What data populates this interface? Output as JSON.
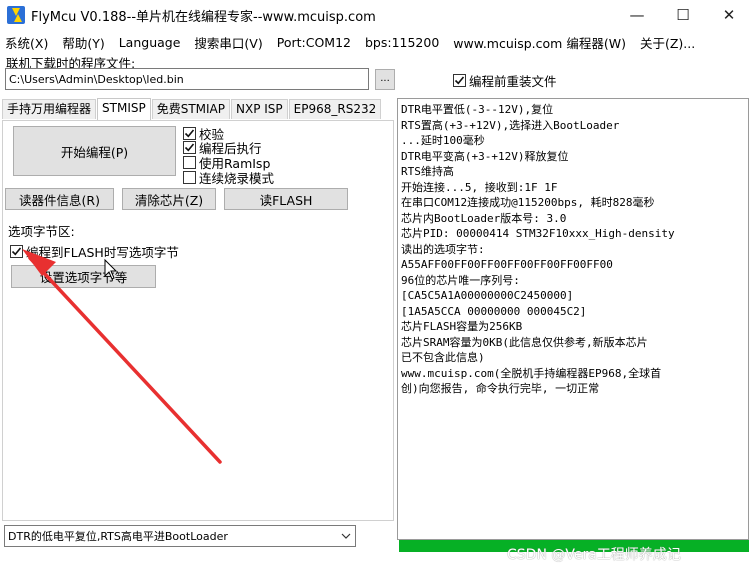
{
  "window": {
    "title": "FlyMcu V0.188--单片机在线编程专家--www.mcuisp.com",
    "minimize": "—",
    "maximize": "☐",
    "close": "✕"
  },
  "menu": [
    "系统(X)",
    "帮助(Y)",
    "Language",
    "搜索串口(V)",
    "Port:COM12",
    "bps:115200",
    "www.mcuisp.com 编程器(W)",
    "关于(Z)..."
  ],
  "program_file": {
    "label": "联机下载时的程序文件:",
    "path": "C:\\Users\\Admin\\Desktop\\led.bin",
    "browse_label": "...",
    "reload_label": "编程前重装文件",
    "reload_checked": true
  },
  "tabs": [
    "手持万用编程器",
    "STMISP",
    "免费STMIAP",
    "NXP ISP",
    "EP968_RS232"
  ],
  "active_tab": "STMISP",
  "buttons": {
    "start_programming": "开始编程(P)",
    "read_device_info": "读器件信息(R)",
    "clear_chip": "清除芯片(Z)",
    "read_flash": "读FLASH",
    "set_option_bytes": "设置选项字节等"
  },
  "options": [
    {
      "label": "校验",
      "checked": true
    },
    {
      "label": "编程后执行",
      "checked": true
    },
    {
      "label": "使用RamIsp",
      "checked": false
    },
    {
      "label": "连续烧录模式",
      "checked": false
    }
  ],
  "option_bytes_group": {
    "title": "选项字节区:",
    "write_option_label": "编程到FLASH时写选项字节",
    "write_option_checked": true
  },
  "bottom_select": {
    "value": "DTR的低电平复位,RTS高电平进BootLoader"
  },
  "log": [
    "DTR电平置低(-3--12V),复位",
    "RTS置高(+3-+12V),选择进入BootLoader",
    "...延时100毫秒",
    "DTR电平变高(+3-+12V)释放复位",
    "RTS维持高",
    "开始连接...5, 接收到:1F 1F",
    "在串口COM12连接成功@115200bps, 耗时828毫秒",
    "芯片内BootLoader版本号: 3.0",
    "芯片PID: 00000414  STM32F10xxx_High-density",
    "读出的选项字节:",
    "A55AFF00FF00FF00FF00FF00FF00FF00",
    "96位的芯片唯一序列号:",
    "[CA5C5A1A00000000C2450000]",
    "[1A5A5CCA 00000000 000045C2]",
    "芯片FLASH容量为256KB",
    "芯片SRAM容量为0KB(此信息仅供参考,新版本芯片",
    "已不包含此信息)",
    "www.mcuisp.com(全脱机手持编程器EP968,全球首",
    "创)向您报告, 命令执行完毕, 一切正常"
  ],
  "progress": 1.0,
  "watermark": "CSDN @Vera工程师养成记",
  "colors": {
    "progress": "#06b025",
    "annotation_arrow": "#e83030"
  }
}
